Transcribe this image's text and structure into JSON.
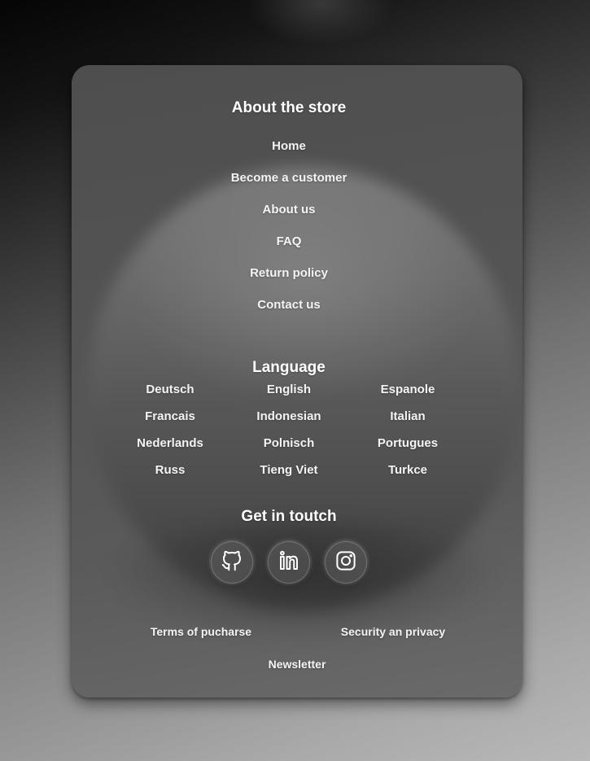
{
  "about": {
    "title": "About the store",
    "links": [
      "Home",
      "Become a customer",
      "About us",
      "FAQ",
      "Return policy",
      "Contact us"
    ]
  },
  "language": {
    "title": "Language",
    "options": [
      "Deutsch",
      "English",
      "Espanole",
      "Francais",
      "Indonesian",
      "Italian",
      "Nederlands",
      "Polnisch",
      "Portugues",
      "Russ",
      "Tieng Viet",
      "Turkce"
    ]
  },
  "contact": {
    "title": "Get in toutch",
    "socials": [
      "github-icon",
      "linkedin-icon",
      "instagram-icon"
    ]
  },
  "footer": {
    "terms": "Terms of pucharse",
    "security": "Security an privacy",
    "newsletter": "Newsletter"
  },
  "colors": {
    "text": "#ffffff",
    "card": "#555555"
  }
}
